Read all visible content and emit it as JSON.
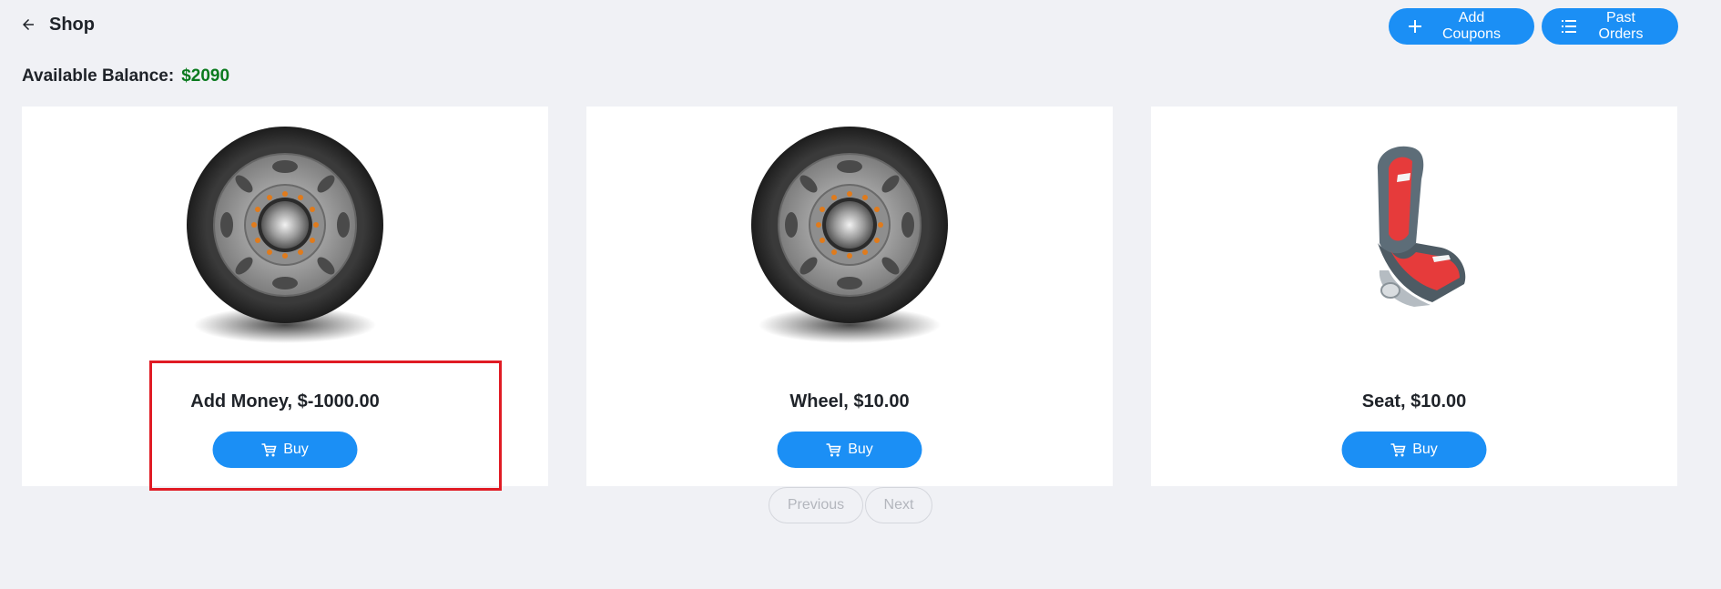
{
  "header": {
    "title": "Shop",
    "add_coupons_label": "Add Coupons",
    "past_orders_label": "Past Orders"
  },
  "balance": {
    "label": "Available Balance:",
    "amount": "$2090"
  },
  "products": [
    {
      "name": "Add Money, $-1000.00",
      "image": "wheel",
      "buy_label": "Buy"
    },
    {
      "name": "Wheel, $10.00",
      "image": "wheel",
      "buy_label": "Buy"
    },
    {
      "name": "Seat, $10.00",
      "image": "seat",
      "buy_label": "Buy"
    }
  ],
  "pagination": {
    "previous_label": "Previous",
    "next_label": "Next"
  },
  "colors": {
    "accent": "#1b8ff5",
    "balance": "#0a7a1e",
    "highlight": "#e01b24",
    "background": "#f0f1f5"
  },
  "icons": {
    "back": "arrow-left-icon",
    "add": "plus-icon",
    "orders": "list-icon",
    "buy": "cart-icon"
  }
}
